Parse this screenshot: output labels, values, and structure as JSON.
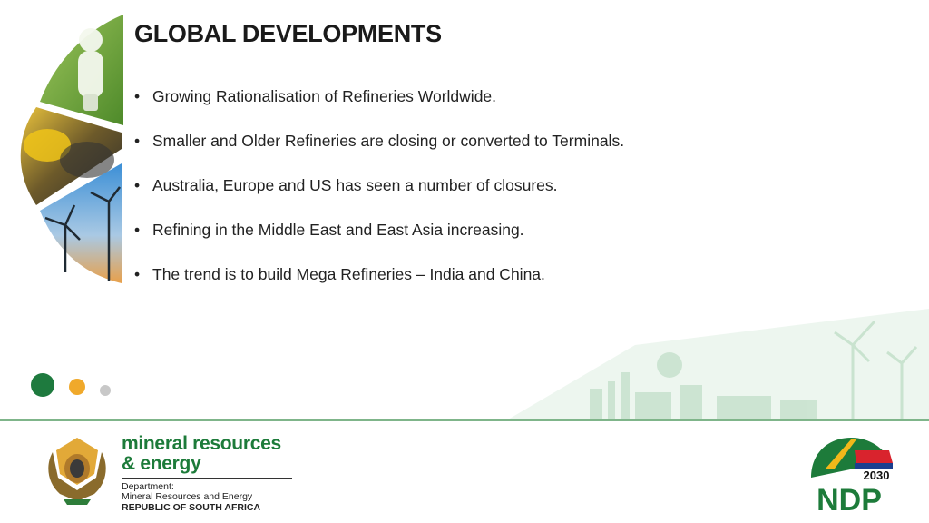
{
  "slide": {
    "title": "GLOBAL DEVELOPMENTS",
    "bullets": [
      "Growing Rationalisation of Refineries Worldwide.",
      "Smaller and Older Refineries are closing or converted to Terminals.",
      "Australia, Europe and US has seen a number of closures.",
      "Refining in the Middle East and East Asia increasing.",
      "The trend is to build Mega Refineries – India and China."
    ]
  },
  "footer": {
    "dept_name_line1": "mineral resources",
    "dept_name_line2": "& energy",
    "dept_label": "Department:",
    "dept_full": "Mineral Resources and Energy",
    "country": "REPUBLIC OF SOUTH AFRICA",
    "ndp_year": "2030",
    "ndp_text": "NDP"
  },
  "colors": {
    "brand_green": "#1d7b3a",
    "dot_green": "#1e7a3e",
    "dot_orange": "#f0a92b",
    "dot_grey": "#c8c8c8"
  },
  "icons": [
    "lightbulb-image",
    "mining-worker-image",
    "wind-turbine-image",
    "coat-of-arms-logo",
    "ndp-2030-logo"
  ]
}
